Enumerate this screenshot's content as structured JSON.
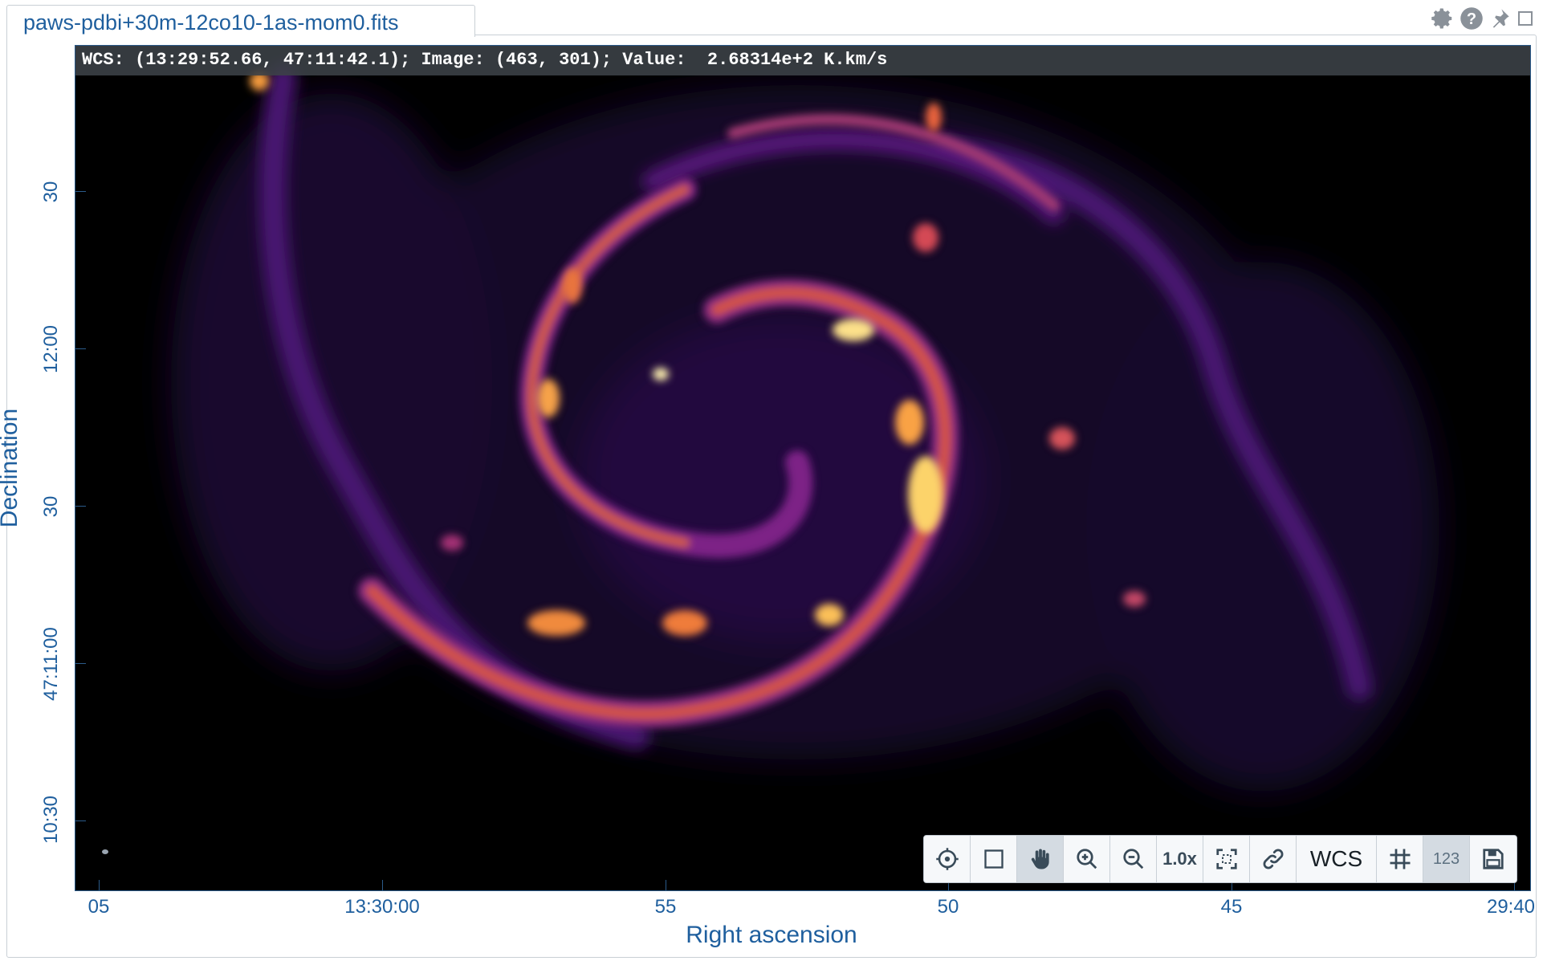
{
  "tab": {
    "title": "paws-pdbi+30m-12co10-1as-mom0.fits"
  },
  "window_controls": [
    "gear-icon",
    "help-icon",
    "pin-icon",
    "maximize-icon"
  ],
  "cursor_info": "WCS: (13:29:52.66, 47:11:42.1); Image: (463, 301); Value:  2.68314e+2 K.km/s",
  "axes": {
    "x_title": "Right ascension",
    "y_title": "Declination",
    "x_ticks": [
      "05",
      "13:30:00",
      "55",
      "50",
      "45",
      "29:40"
    ],
    "y_ticks": [
      "30",
      "12:00",
      "30",
      "47:11:00",
      "10:30"
    ]
  },
  "colormap": "inferno",
  "toolbar": {
    "zoom_label": "1.0x",
    "wcs_label": "WCS",
    "stats_label": "123",
    "active_tool": "pan"
  }
}
